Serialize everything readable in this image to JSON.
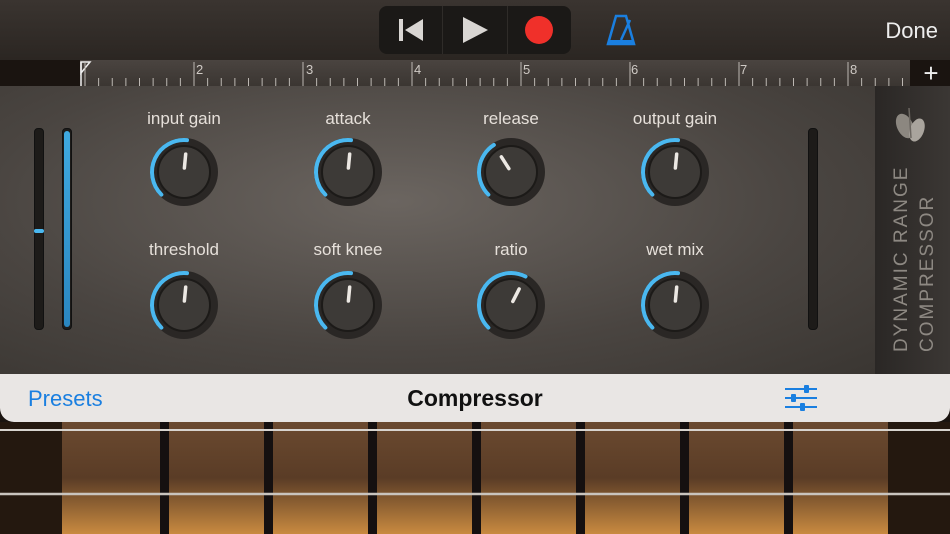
{
  "header": {
    "done_label": "Done",
    "transport": {
      "rewind_icon": "skip-to-start-icon",
      "play_icon": "play-icon",
      "record_icon": "record-icon",
      "record_color": "#f0302a"
    },
    "metronome_icon": "metronome-icon",
    "accent_color": "#1a7fe0"
  },
  "ruler": {
    "bars": [
      "2",
      "3",
      "4",
      "5",
      "6",
      "7",
      "8"
    ],
    "add_icon": "plus-icon"
  },
  "plugin": {
    "side_title_line1": "DYNAMIC RANGE",
    "side_title_line2": "COMPRESSOR",
    "logo_icon": "leaf-logo-icon",
    "knobs": [
      {
        "label": "input gain",
        "value": 0.52
      },
      {
        "label": "attack",
        "value": 0.52
      },
      {
        "label": "release",
        "value": 0.38
      },
      {
        "label": "output gain",
        "value": 0.52
      },
      {
        "label": "threshold",
        "value": 0.52
      },
      {
        "label": "soft knee",
        "value": 0.52
      },
      {
        "label": "ratio",
        "value": 0.6
      },
      {
        "label": "wet mix",
        "value": 0.52
      }
    ],
    "knob_arc_color": "#4ab8f0"
  },
  "toolbar": {
    "presets_label": "Presets",
    "title": "Compressor",
    "settings_icon": "sliders-icon"
  }
}
